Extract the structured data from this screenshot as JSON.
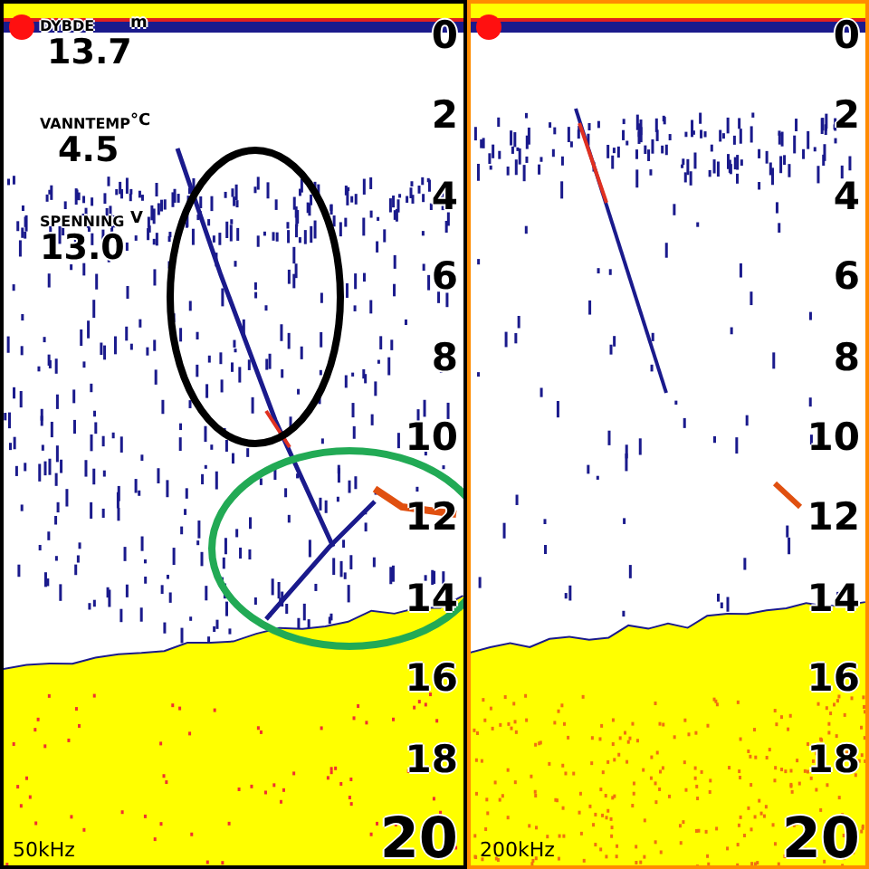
{
  "panels": [
    {
      "frequency": "50kHz",
      "selected": false,
      "readouts": [
        {
          "label": "DYBDE",
          "unit": "m",
          "value": "13.7"
        },
        {
          "label": "VANNTEMP",
          "unit": "°C",
          "value": "4.5"
        },
        {
          "label": "SPENNING",
          "unit": "V",
          "value": "13.0"
        }
      ],
      "depth_scale": [
        "0",
        "2",
        "4",
        "6",
        "8",
        "10",
        "12",
        "14",
        "16",
        "18",
        "20"
      ]
    },
    {
      "frequency": "200kHz",
      "selected": true,
      "depth_scale": [
        "0",
        "2",
        "4",
        "6",
        "8",
        "10",
        "12",
        "14",
        "16",
        "18",
        "20"
      ]
    }
  ]
}
